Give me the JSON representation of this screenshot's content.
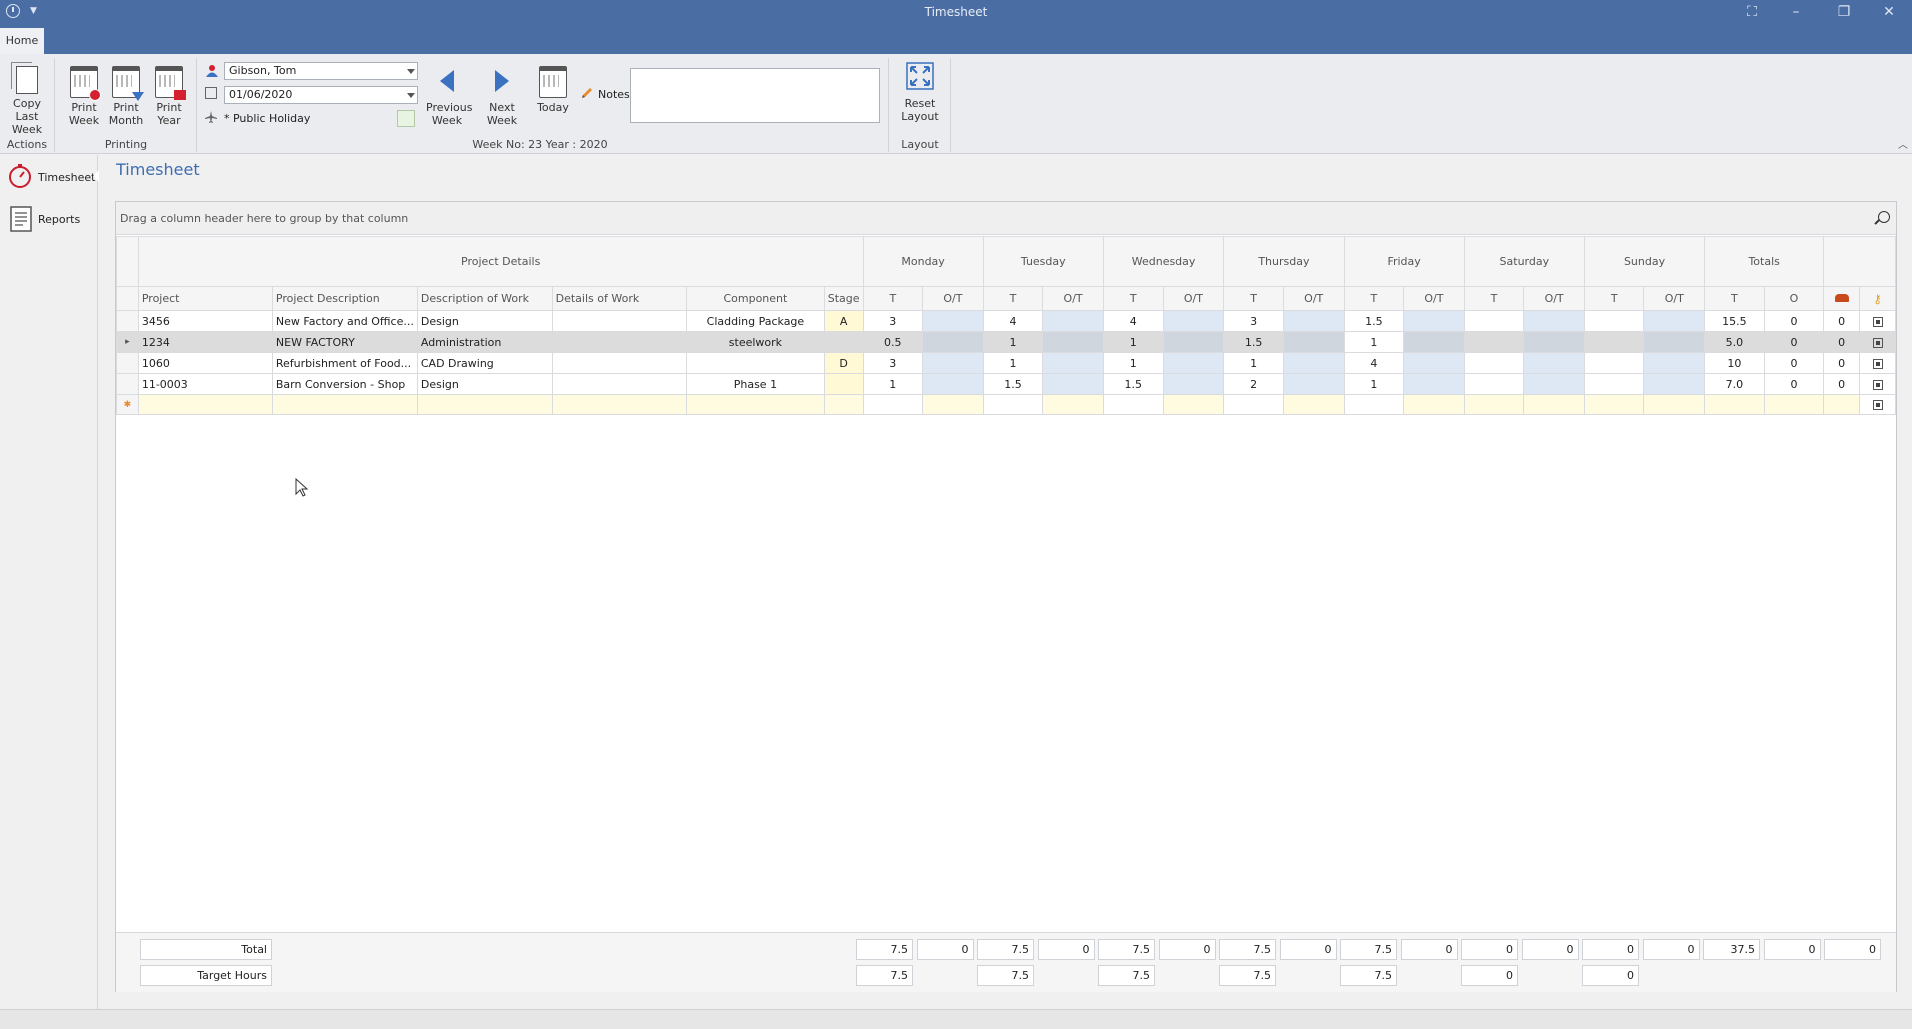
{
  "window": {
    "title": "Timesheet"
  },
  "ribbon": {
    "tab_home": "Home",
    "actions": {
      "copy_last_week": "Copy Last Week",
      "group": "Actions"
    },
    "printing": {
      "print_week": "Print Week",
      "print_month": "Print Month",
      "print_year": "Print Year",
      "group": "Printing"
    },
    "employee": "Gibson, Tom",
    "date": "01/06/2020",
    "public_holiday": "* Public Holiday",
    "previous_week": "Previous Week",
    "next_week": "Next Week",
    "today": "Today",
    "notes": "Notes",
    "week_info": "Week No: 23 Year : 2020",
    "layout": {
      "reset_layout": "Reset Layout",
      "group": "Layout"
    }
  },
  "nav": {
    "timesheet": "Timesheet",
    "reports": "Reports"
  },
  "page": {
    "title": "Timesheet",
    "group_hint": "Drag a column header here to group by that column"
  },
  "grid": {
    "band_project": "Project Details",
    "days": [
      "Monday",
      "Tuesday",
      "Wednesday",
      "Thursday",
      "Friday",
      "Saturday",
      "Sunday"
    ],
    "band_totals": "Totals",
    "columns": {
      "project": "Project",
      "project_description": "Project Description",
      "description_of_work": "Description of Work",
      "details_of_work": "Details of Work",
      "component": "Component",
      "stage": "Stage",
      "t": "T",
      "ot": "O/T",
      "o": "O"
    },
    "rows": [
      {
        "project": "3456",
        "desc": "New Factory and Office...",
        "work": "Design",
        "details": "",
        "component": "Cladding Package",
        "stage": "A",
        "mon": "3",
        "tue": "4",
        "wed": "4",
        "thu": "3",
        "fri": "1.5",
        "sat": "",
        "sun": "",
        "tot_t": "15.5",
        "tot_o": "0",
        "extra": "0"
      },
      {
        "project": "1234",
        "desc": "NEW FACTORY",
        "work": "Administration",
        "details": "",
        "component": "steelwork",
        "stage": "",
        "mon": "0.5",
        "tue": "1",
        "wed": "1",
        "thu": "1.5",
        "fri": "1",
        "sat": "",
        "sun": "",
        "tot_t": "5.0",
        "tot_o": "0",
        "extra": "0"
      },
      {
        "project": "1060",
        "desc": "Refurbishment of Food...",
        "work": "CAD Drawing",
        "details": "",
        "component": "",
        "stage": "D",
        "mon": "3",
        "tue": "1",
        "wed": "1",
        "thu": "1",
        "fri": "4",
        "sat": "",
        "sun": "",
        "tot_t": "10",
        "tot_o": "0",
        "extra": "0"
      },
      {
        "project": "11-0003",
        "desc": "Barn Conversion - Shop",
        "work": "Design",
        "details": "",
        "component": "Phase 1",
        "stage": "",
        "mon": "1",
        "tue": "1.5",
        "wed": "1.5",
        "thu": "2",
        "fri": "1",
        "sat": "",
        "sun": "",
        "tot_t": "7.0",
        "tot_o": "0",
        "extra": "0"
      }
    ]
  },
  "footer": {
    "total_label": "Total",
    "target_label": "Target Hours",
    "totals": [
      "7.5",
      "0",
      "7.5",
      "0",
      "7.5",
      "0",
      "7.5",
      "0",
      "7.5",
      "0",
      "0",
      "0",
      "0",
      "0",
      "37.5",
      "0",
      "0"
    ],
    "targets": [
      "7.5",
      "7.5",
      "7.5",
      "7.5",
      "7.5",
      "0",
      "0"
    ]
  },
  "colors": {
    "titlebar": "#4a6da3",
    "accent": "#3f6db2",
    "ot_cell": "#dde8f4",
    "new_row": "#fffbe0"
  }
}
